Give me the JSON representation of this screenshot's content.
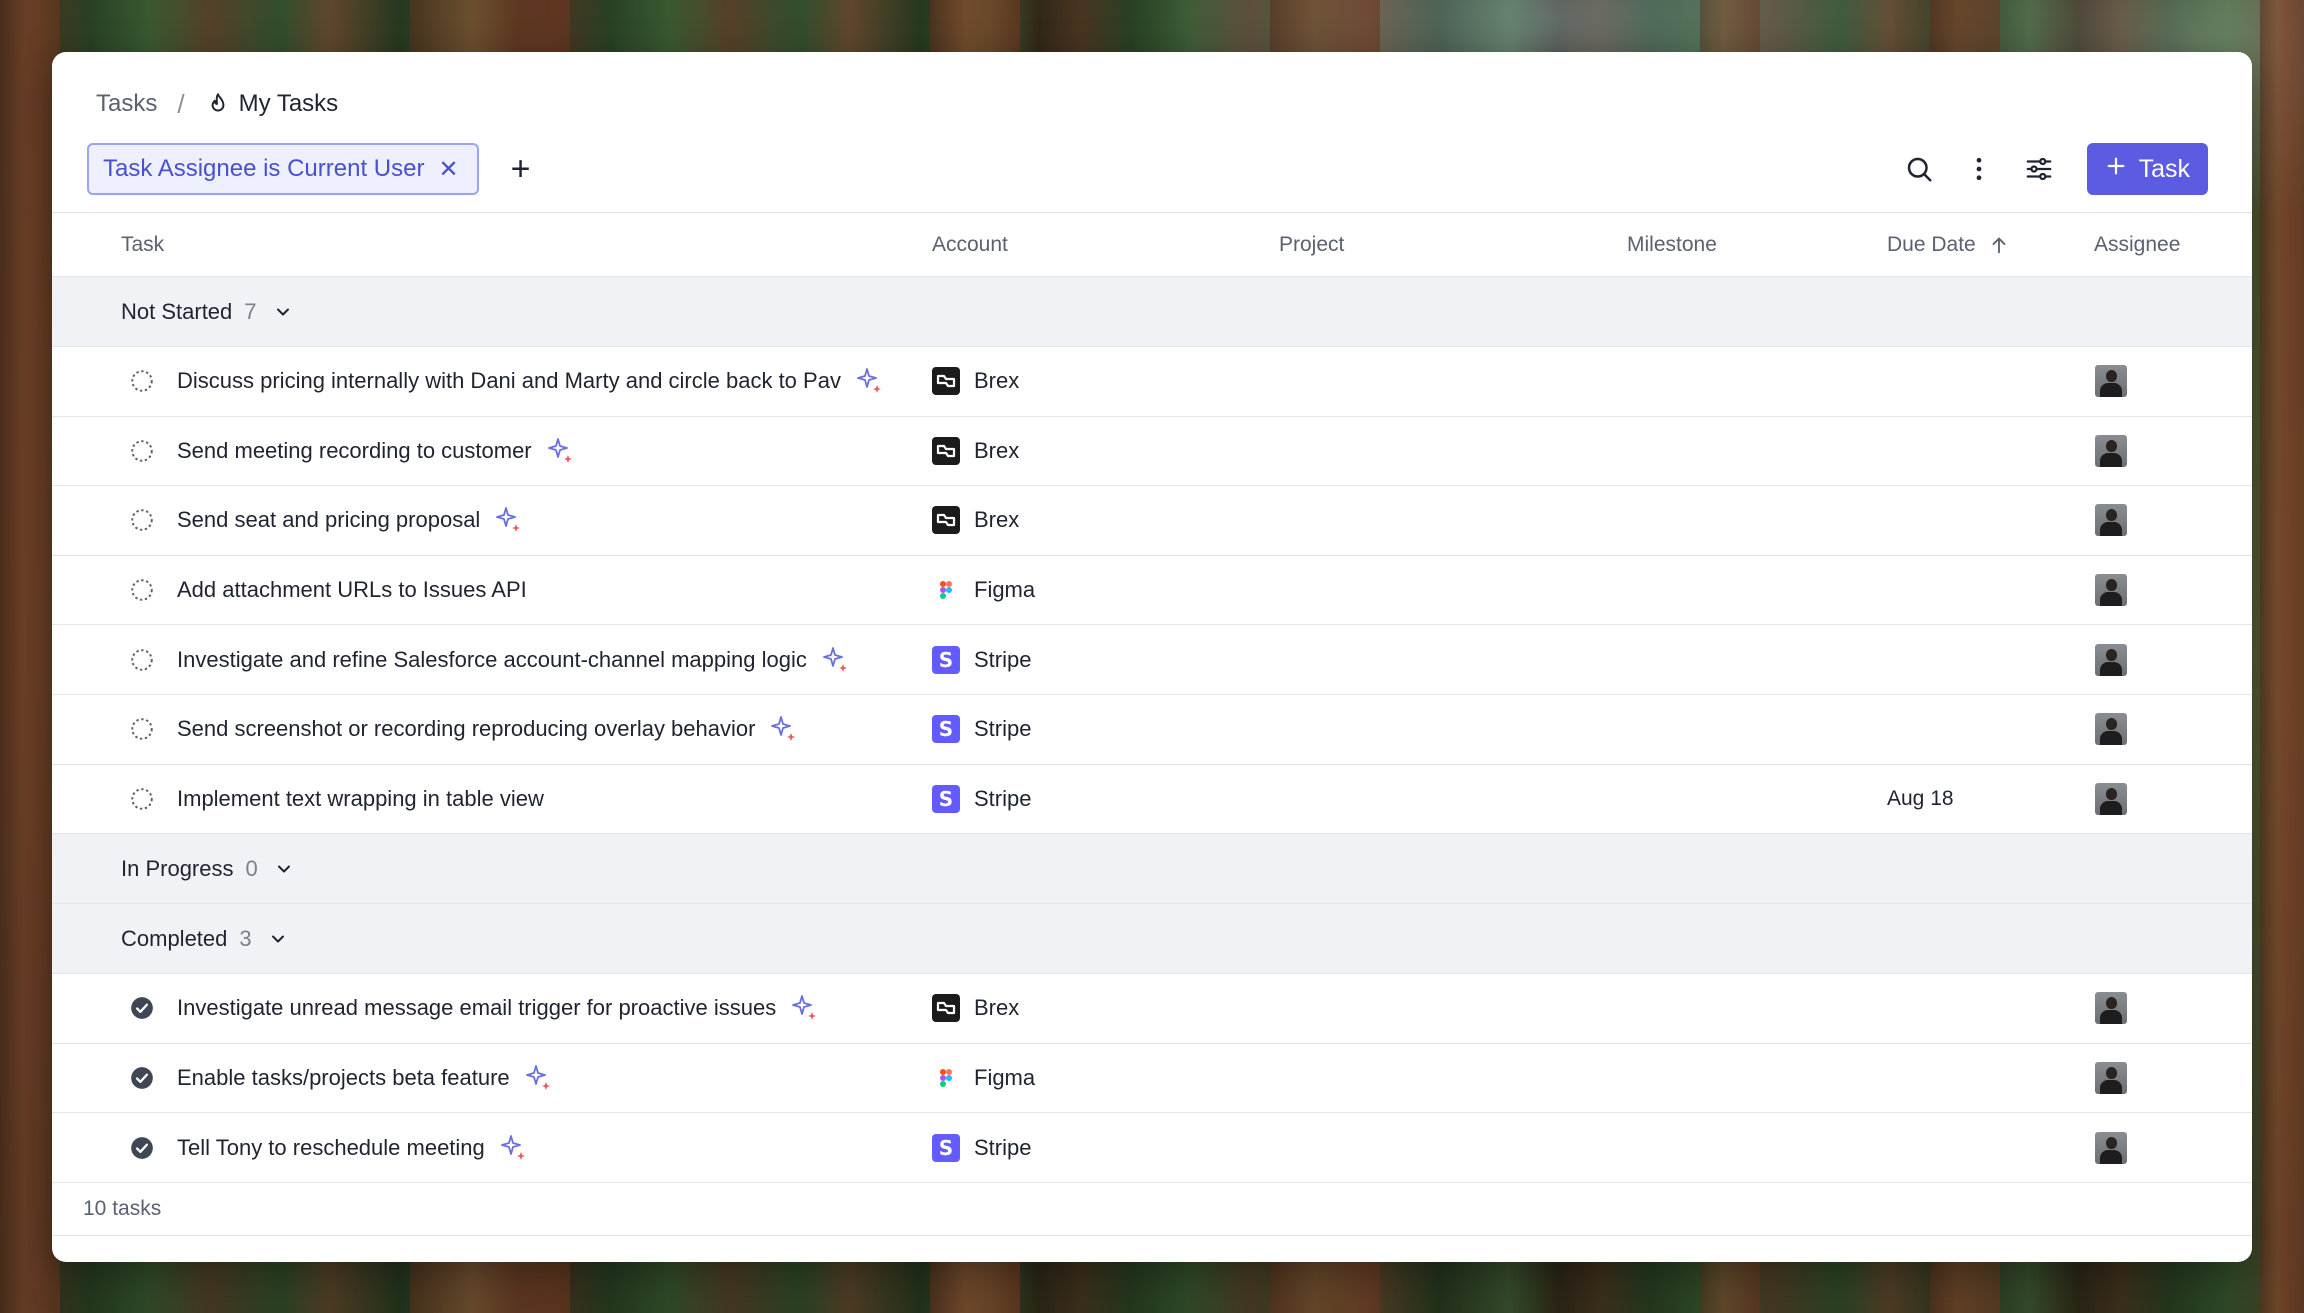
{
  "breadcrumb": {
    "root": "Tasks",
    "separator": "/",
    "current": "My Tasks",
    "current_icon": "flame-icon"
  },
  "toolbar": {
    "filter_chip": "Task Assignee is Current User",
    "filter_remove": "✕",
    "add_filter": "+",
    "icons": [
      "search-icon",
      "more-vertical-icon",
      "sliders-icon"
    ],
    "new_task_label": "Task"
  },
  "table": {
    "columns": {
      "task": "Task",
      "account": "Account",
      "project": "Project",
      "milestone": "Milestone",
      "due_date": "Due Date",
      "assignee": "Assignee"
    },
    "sort": {
      "column": "due_date",
      "direction": "ascending"
    }
  },
  "groups": [
    {
      "label": "Not Started",
      "count": "7",
      "tasks": [
        {
          "title": "Discuss pricing internally with Dani and Marty and circle back to Pav",
          "ai": true,
          "account": "Brex",
          "due": ""
        },
        {
          "title": "Send meeting recording to customer",
          "ai": true,
          "account": "Brex",
          "due": ""
        },
        {
          "title": "Send seat and pricing proposal",
          "ai": true,
          "account": "Brex",
          "due": ""
        },
        {
          "title": "Add attachment URLs to Issues API",
          "ai": false,
          "account": "Figma",
          "due": ""
        },
        {
          "title": "Investigate and refine Salesforce account-channel mapping logic",
          "ai": true,
          "account": "Stripe",
          "due": ""
        },
        {
          "title": "Send screenshot or recording reproducing overlay behavior",
          "ai": true,
          "account": "Stripe",
          "due": ""
        },
        {
          "title": "Implement text wrapping in table view",
          "ai": false,
          "account": "Stripe",
          "due": "Aug 18"
        }
      ]
    },
    {
      "label": "In Progress",
      "count": "0",
      "tasks": []
    },
    {
      "label": "Completed",
      "count": "3",
      "tasks": [
        {
          "title": "Investigate unread message email trigger for proactive issues",
          "ai": true,
          "account": "Brex",
          "due": ""
        },
        {
          "title": "Enable tasks/projects beta feature",
          "ai": true,
          "account": "Figma",
          "due": ""
        },
        {
          "title": "Tell Tony to reschedule meeting",
          "ai": true,
          "account": "Stripe",
          "due": ""
        }
      ]
    }
  ],
  "footer": {
    "count_label": "10 tasks"
  },
  "colors": {
    "accent": "#5b5ce2",
    "filter_chip_bg": "#eef0ff",
    "filter_chip_border": "#9aa3f4",
    "group_bg": "#f0f2f6",
    "stripe": "#635bff",
    "brex": "#1b1b1b"
  }
}
